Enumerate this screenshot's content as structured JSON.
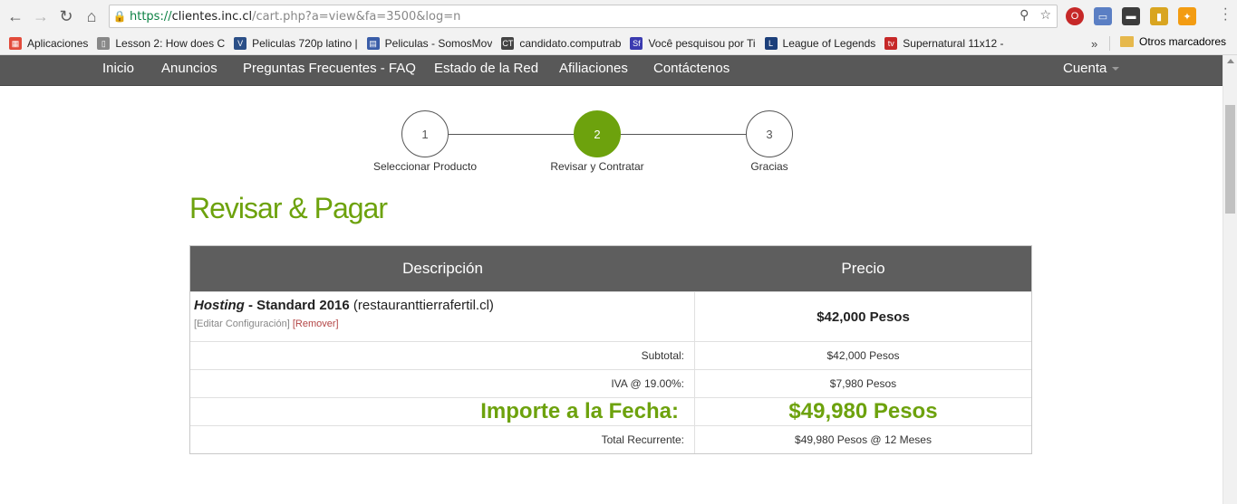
{
  "browser": {
    "url_https": "https://",
    "url_host": "clientes.inc.cl",
    "url_path": "/cart.php?a=view&fa=3500&log=n",
    "bookmarks": [
      {
        "label": "Aplicaciones",
        "icon": "apps-grid-icon",
        "color": "#e24b3b"
      },
      {
        "label": "Lesson 2: How does C",
        "icon": "page-icon",
        "color": "#888888"
      },
      {
        "label": "Peliculas 720p latino |",
        "icon": "v-logo-icon",
        "color": "#2b4f87"
      },
      {
        "label": "Peliculas - SomosMov",
        "icon": "film-icon",
        "color": "#3a5da8"
      },
      {
        "label": "candidato.computrab",
        "icon": "ct-logo-icon",
        "color": "#444444"
      },
      {
        "label": "Você pesquisou por Ti",
        "icon": "sf-logo-icon",
        "color": "#3b3bb0"
      },
      {
        "label": "League of Legends",
        "icon": "lol-logo-icon",
        "color": "#1c3f7a"
      },
      {
        "label": "Supernatural 11x12 -",
        "icon": "tv-logo-icon",
        "color": "#c62828"
      }
    ],
    "other_bookmarks": "Otros marcadores",
    "overflow_chevron": "»"
  },
  "nav": {
    "items": [
      "Inicio",
      "Anuncios",
      "Preguntas Frecuentes - FAQ",
      "Estado de la Red",
      "Afiliaciones",
      "Contáctenos"
    ],
    "account": "Cuenta"
  },
  "steps": [
    {
      "number": "1",
      "label": "Seleccionar Producto",
      "active": false
    },
    {
      "number": "2",
      "label": "Revisar y Contratar",
      "active": true
    },
    {
      "number": "3",
      "label": "Gracias",
      "active": false
    }
  ],
  "page_title": "Revisar & Pagar",
  "table": {
    "header_description": "Descripción",
    "header_price": "Precio",
    "item": {
      "category": "Hosting",
      "separator": " - ",
      "product": "Standard 2016",
      "domain": " (restauranttierrafertil.cl)",
      "edit_link": "[Editar Configuración]",
      "remove_link": "[Remover]",
      "price": "$42,000 Pesos"
    },
    "subtotal_label": "Subtotal:",
    "subtotal_value": "$42,000 Pesos",
    "tax_label": "IVA @ 19.00%:",
    "tax_value": "$7,980 Pesos",
    "total_label": "Importe a la Fecha:",
    "total_value": "$49,980 Pesos",
    "recurring_label": "Total Recurrente:",
    "recurring_value": "$49,980 Pesos @ 12 Meses"
  },
  "colors": {
    "accent": "#6da20d",
    "nav_bg": "#585858",
    "table_header_bg": "#5e5e5e",
    "remove_link": "#b34444"
  }
}
